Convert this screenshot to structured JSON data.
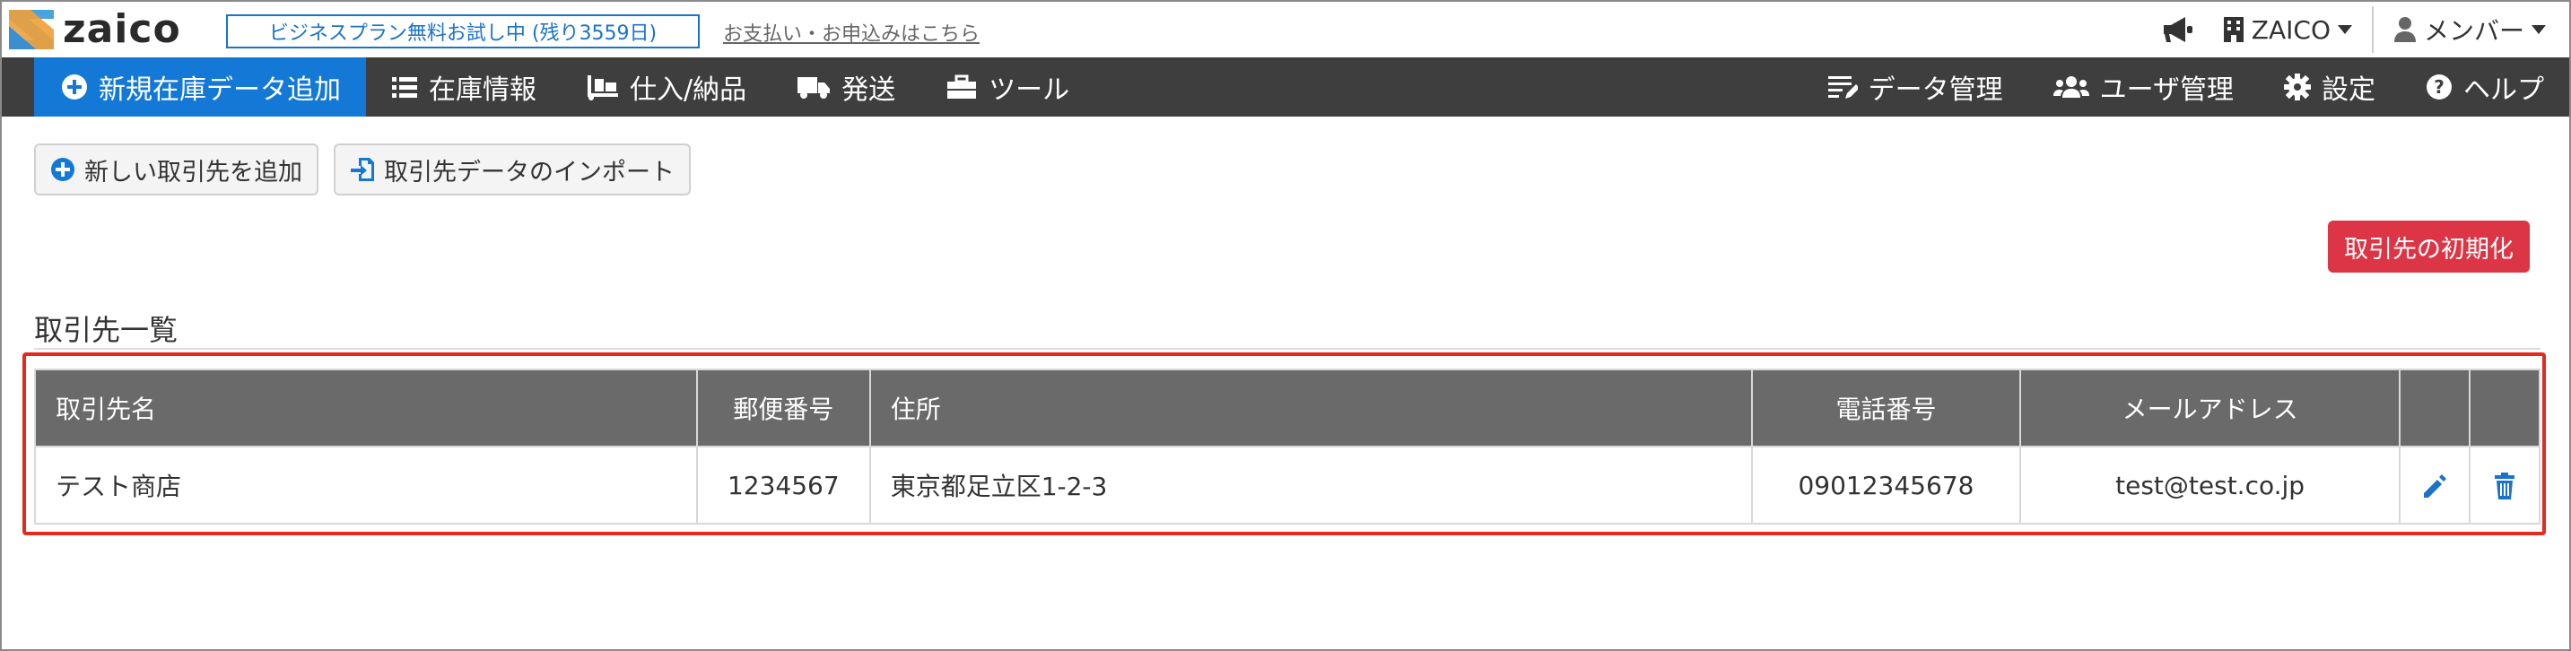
{
  "app": {
    "logo_text": "zaico"
  },
  "topbar": {
    "trial_label": "ビジネスプラン無料お試し中 (残り3559日)",
    "pay_link": "お支払い・お申込みはこちら",
    "company_label": "ZAICO",
    "member_label": "メンバー"
  },
  "nav": {
    "add_label": "新規在庫データ追加",
    "inventory_label": "在庫情報",
    "purchase_label": "仕入/納品",
    "shipping_label": "発送",
    "tools_label": "ツール",
    "data_mgmt_label": "データ管理",
    "user_mgmt_label": "ユーザ管理",
    "settings_label": "設定",
    "help_label": "ヘルプ"
  },
  "actions": {
    "add_supplier_label": "新しい取引先を追加",
    "import_label": "取引先データのインポート",
    "reset_label": "取引先の初期化"
  },
  "section": {
    "title": "取引先一覧"
  },
  "table": {
    "headers": [
      "取引先名",
      "郵便番号",
      "住所",
      "電話番号",
      "メールアドレス"
    ],
    "rows": [
      {
        "name": "テスト商店",
        "postal": "1234567",
        "address": "東京都足立区1-2-3",
        "phone": "09012345678",
        "email": "test@test.co.jp"
      }
    ]
  },
  "colors": {
    "accent": "#1479d6",
    "danger": "#dc3545",
    "nav_bg": "#3e3e3e",
    "header_bg": "#6a6a6a",
    "highlight": "#e42a1e"
  },
  "icons": [
    "zaico-logo",
    "megaphone-icon",
    "building-icon",
    "user-icon",
    "plus-circle-icon",
    "list-icon",
    "dolly-icon",
    "truck-icon",
    "toolbox-icon",
    "data-edit-icon",
    "users-icon",
    "gear-icon",
    "question-icon",
    "file-import-icon",
    "pencil-icon",
    "trash-icon"
  ]
}
